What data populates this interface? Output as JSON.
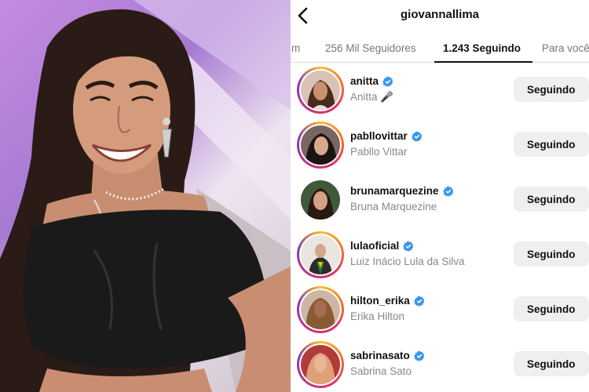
{
  "profile": {
    "username": "giovannallima"
  },
  "tabs": [
    {
      "label": "m"
    },
    {
      "label": "256 Mil Seguidores"
    },
    {
      "label": "1.243 Seguindo"
    },
    {
      "label": "Para você"
    }
  ],
  "following": [
    {
      "username": "anitta",
      "fullname": "Anitta 🎤",
      "button": "Seguindo"
    },
    {
      "username": "pabllovittar",
      "fullname": "Pabllo Vittar",
      "button": "Seguindo"
    },
    {
      "username": "brunamarquezine",
      "fullname": "Bruna Marquezine",
      "button": "Seguindo"
    },
    {
      "username": "lulaoficial",
      "fullname": "Luiz Inácio Lula da Silva",
      "button": "Seguindo"
    },
    {
      "username": "hilton_erika",
      "fullname": "Erika Hilton",
      "button": "Seguindo"
    },
    {
      "username": "sabrinasato",
      "fullname": "Sabrina Sato",
      "button": "Seguindo"
    }
  ],
  "colors": {
    "verified": "#3897f0",
    "button_bg": "#efefef"
  }
}
